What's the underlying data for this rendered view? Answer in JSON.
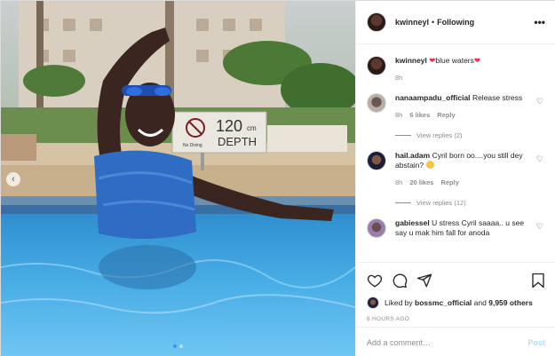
{
  "photo": {
    "sign_depth_number": "120",
    "sign_depth_unit": "cm",
    "sign_depth_word": "DEPTH",
    "sign_no_diving": "No Diving",
    "carousel_dots": 2,
    "carousel_active_index": 1
  },
  "post": {
    "username": "kwinneyl",
    "separator": "•",
    "follow_status": "Following",
    "more_icon": "more-horizontal-icon"
  },
  "caption": {
    "username": "kwinneyl",
    "text": "blue waters",
    "time": "8h"
  },
  "comments": [
    {
      "username": "nanaampadu_official",
      "text": "Release stress",
      "time": "8h",
      "likes": "6 likes",
      "reply": "Reply",
      "view_replies": "View replies (2)"
    },
    {
      "username": "hail.adam",
      "text": "Cyril born oo....you still dey abstain?",
      "time": "8h",
      "likes": "20 likes",
      "reply": "Reply",
      "view_replies": "View replies (12)"
    },
    {
      "username": "gabiessel",
      "text": "U stress Cyril saaaa.. u see say u mak him fall for anoda"
    }
  ],
  "likes": {
    "prefix": "Liked by",
    "user": "bossmc_official",
    "and": "and",
    "others": "9,959 others"
  },
  "timestamp": "8 HOURS AGO",
  "comment_box": {
    "placeholder": "Add a comment…",
    "post_label": "Post"
  },
  "colors": {
    "link_blue": "#3897f0",
    "post_disabled": "#b2dffc",
    "heart_red": "#ed2f4a",
    "muted": "#8e8e8e"
  }
}
